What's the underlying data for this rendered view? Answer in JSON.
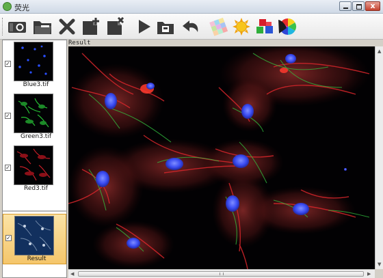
{
  "window": {
    "title": "荧光",
    "controls": [
      "minimize",
      "maximize",
      "close"
    ]
  },
  "toolbar": {
    "buttons": [
      {
        "name": "camera-capture",
        "icon": "camera-icon"
      },
      {
        "name": "open-folder",
        "icon": "folder-open-icon"
      },
      {
        "name": "delete",
        "icon": "close-x-icon"
      },
      {
        "name": "add-image",
        "icon": "file-add-icon"
      },
      {
        "name": "remove-image",
        "icon": "file-remove-icon"
      },
      {
        "name": "run",
        "icon": "play-icon"
      },
      {
        "name": "save",
        "icon": "save-folder-icon"
      },
      {
        "name": "undo",
        "icon": "undo-icon"
      },
      {
        "name": "color-mosaic",
        "icon": "color-mosaic-icon"
      },
      {
        "name": "brightness",
        "icon": "sun-icon"
      },
      {
        "name": "rgb-channels",
        "icon": "rgb-cubes-icon"
      },
      {
        "name": "color-wheel",
        "icon": "color-wheel-icon"
      }
    ]
  },
  "channels": [
    {
      "label": "Blue3.tif",
      "checked": true,
      "color": "#2a4fff",
      "check_mark": "✓"
    },
    {
      "label": "Green3.tif",
      "checked": true,
      "color": "#2bd43a",
      "check_mark": "✓"
    },
    {
      "label": "Red3.tif",
      "checked": true,
      "color": "#e0202a",
      "check_mark": "✓"
    }
  ],
  "result_item": {
    "label": "Result",
    "checked": true,
    "selected": true,
    "check_mark": "✓"
  },
  "viewer": {
    "caption": "Result"
  },
  "colors": {
    "selection": "#f5c66b",
    "viewer_bg": "#020103"
  }
}
